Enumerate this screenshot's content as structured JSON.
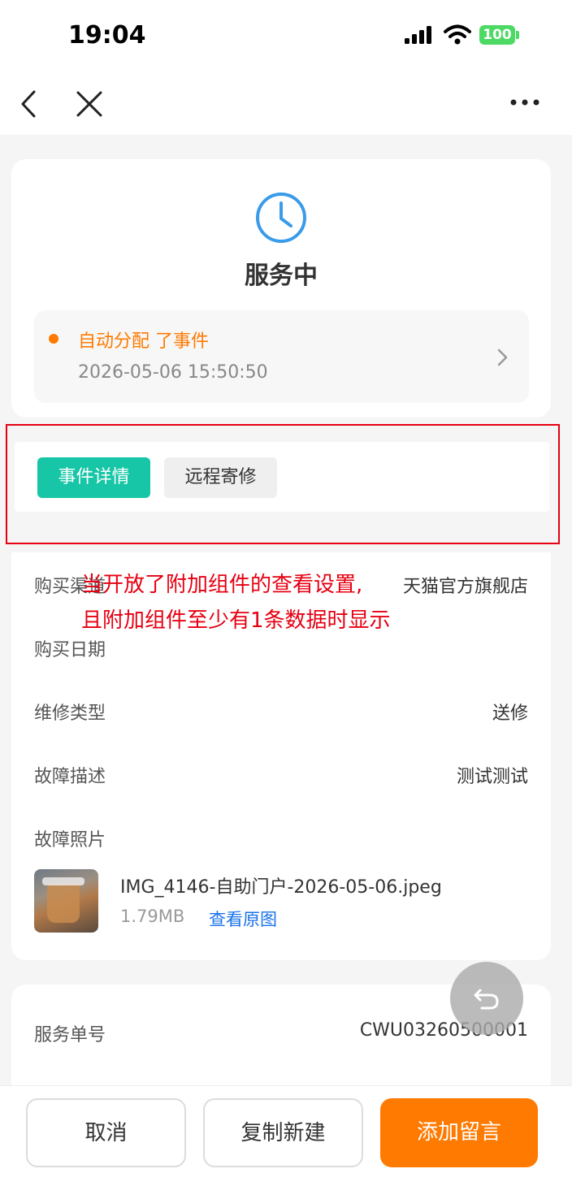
{
  "statusbar": {
    "time": "19:04",
    "battery": "100"
  },
  "navbar": {
    "back_icon": "chevron-left-icon",
    "close_icon": "close-icon",
    "more_icon": "more-icon"
  },
  "status": {
    "icon": "clock-icon",
    "title": "服务中",
    "timeline": {
      "event": "自动分配 了事件",
      "time": "2026-05-06 15:50:50"
    }
  },
  "tabs": [
    {
      "label": "事件详情",
      "active": true
    },
    {
      "label": "远程寄修",
      "active": false
    }
  ],
  "annotation": {
    "line1": "当开放了附加组件的查看设置,",
    "line2": "且附加组件至少有1条数据时显示",
    "color": "#e60012"
  },
  "details": {
    "purchase_channel": {
      "label": "购买渠道",
      "value": "天猫官方旗舰店"
    },
    "purchase_date": {
      "label": "购买日期",
      "value": ""
    },
    "repair_type": {
      "label": "维修类型",
      "value": "送修"
    },
    "fault_desc": {
      "label": "故障描述",
      "value": "测试测试"
    },
    "fault_photo": {
      "label": "故障照片",
      "file_name": "IMG_4146-自助门户-2026-05-06.jpeg",
      "file_size": "1.79MB",
      "view_label": "查看原图"
    }
  },
  "service": {
    "label": "服务单号",
    "value": "CWU03260500001"
  },
  "footer": {
    "cancel": "取消",
    "copy_new": "复制新建",
    "add_message": "添加留言"
  },
  "colors": {
    "accent": "#ff7a00",
    "tab_active": "#16c6a6",
    "link": "#1a73e8"
  }
}
